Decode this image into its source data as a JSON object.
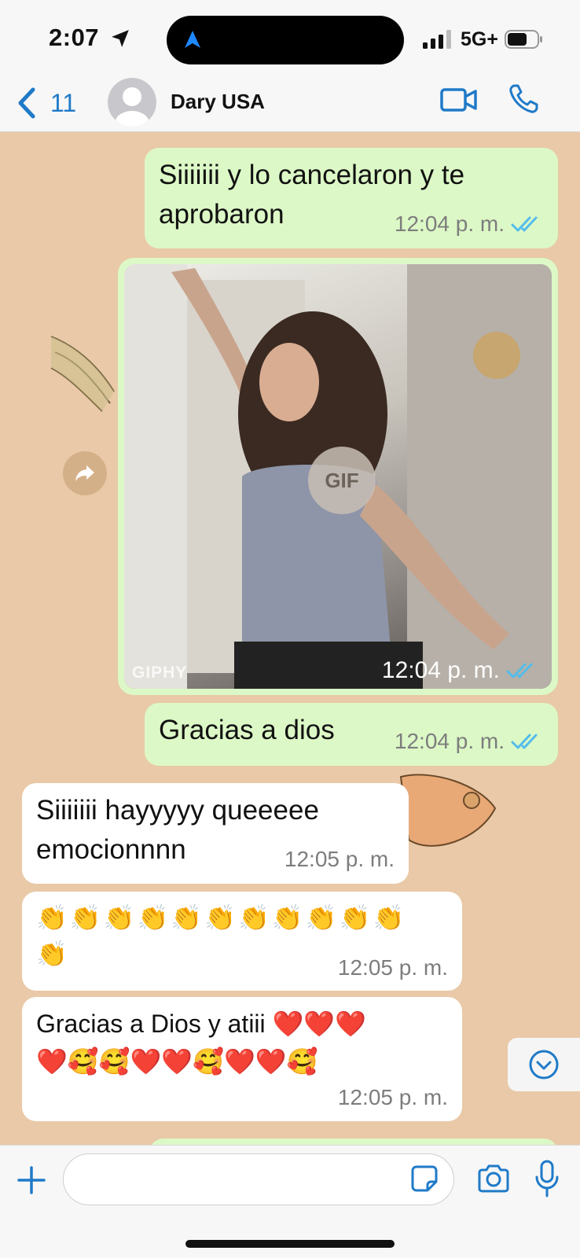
{
  "status_bar": {
    "time": "2:07",
    "network": "5G+",
    "icons": [
      "location-arrow-icon",
      "signal-icon",
      "battery-icon"
    ]
  },
  "header": {
    "back_count": "11",
    "contact_name": "Dary USA",
    "icons": [
      "chevron-left-icon",
      "avatar-icon",
      "video-call-icon",
      "phone-icon"
    ],
    "accent_color": "#1f7ac8"
  },
  "messages": [
    {
      "direction": "outgoing",
      "type": "text",
      "text": "Siiiiiii y lo cancelaron y te\naprobaron",
      "time": "12:04",
      "ampm": "p. m.",
      "read": true
    },
    {
      "direction": "outgoing",
      "type": "gif",
      "badge": "GIF",
      "source": "GIPHY",
      "time": "12:04",
      "ampm": "p. m.",
      "read": true
    },
    {
      "direction": "outgoing",
      "type": "text",
      "text": "Gracias a dios",
      "time": "12:04",
      "ampm": "p. m.",
      "read": true
    },
    {
      "direction": "incoming",
      "type": "text",
      "text": "Siiiiiii hayyyyy queeeee\nemocionnnn",
      "time": "12:05",
      "ampm": "p. m."
    },
    {
      "direction": "incoming",
      "type": "text",
      "text": "👏👏👏👏👏👏👏👏👏👏👏\n👏",
      "time": "12:05",
      "ampm": "p. m."
    },
    {
      "direction": "incoming",
      "type": "text",
      "text": "Gracias a Dios y atiii ❤️❤️❤️\n❤️🥰🥰❤️❤️🥰❤️❤️🥰",
      "time": "12:05",
      "ampm": "p. m."
    }
  ],
  "colors": {
    "outgoing_bubble": "#dcf8c6",
    "incoming_bubble": "#ffffff",
    "chat_background": "#e9c9a7",
    "read_ticks": "#53bdeb"
  },
  "input_bar": {
    "placeholder": "",
    "icons": [
      "plus-icon",
      "sticker-icon",
      "camera-icon",
      "microphone-icon"
    ]
  }
}
